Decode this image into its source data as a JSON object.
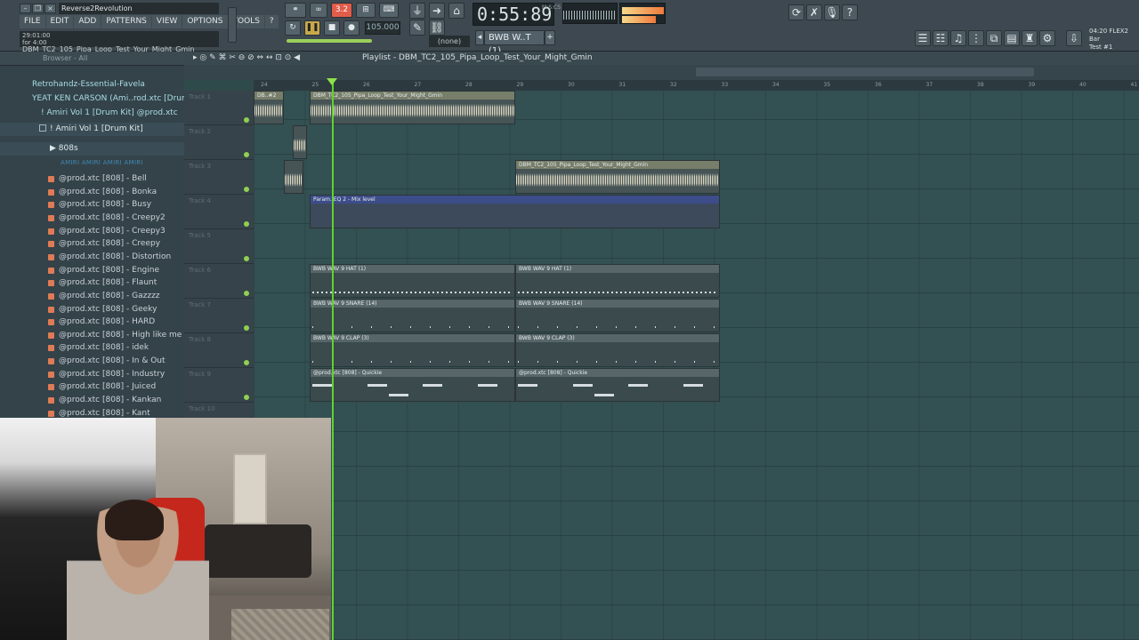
{
  "window": {
    "song_title": "Reverse2Revolution",
    "hint_line1": "29:01:00",
    "hint_line2": "for 4:00",
    "hint_file": "DBM_TC2_105_Pipa_Loop_Test_Your_Might_Gmin"
  },
  "menu": [
    "FILE",
    "EDIT",
    "ADD",
    "PATTERNS",
    "VIEW",
    "OPTIONS",
    "TOOLS",
    "?"
  ],
  "transport": {
    "pattern_indicator": "3.2",
    "tempo": "105.000",
    "time": "0:55:89",
    "time_unit": "M:S:CS",
    "pattern_select": "(none)",
    "channel_select": "BWB W..T (1)"
  },
  "info_right": {
    "line1": "04:20 FLEX2 Bar",
    "line2": "Test #1"
  },
  "browser": {
    "header": "Browser - All",
    "folders": [
      "Retrohandz-Essential-Favela",
      "YEAT KEN CARSON (Ami..rod.xtc [Drum Kit]",
      "! Amiri Vol 1 [Drum Kit] @prod.xtc",
      "! Amiri Vol 1 [Drum Kit]",
      "808s"
    ],
    "subfolder_tag": "AMIRI AMIRI AMIRI AMIRI",
    "files": [
      "@prod.xtc [808] - Bell",
      "@prod.xtc [808] - Bonka",
      "@prod.xtc [808] - Busy",
      "@prod.xtc [808] - Creepy2",
      "@prod.xtc [808] - Creepy3",
      "@prod.xtc [808] - Creepy",
      "@prod.xtc [808] - Distortion",
      "@prod.xtc [808] - Engine",
      "@prod.xtc [808] - Flaunt",
      "@prod.xtc [808] - Gazzzz",
      "@prod.xtc [808] - Geeky",
      "@prod.xtc [808] - HARD",
      "@prod.xtc [808] - High like me",
      "@prod.xtc [808] - idek",
      "@prod.xtc [808] - In & Out",
      "@prod.xtc [808] - Industry",
      "@prod.xtc [808] - Juiced",
      "@prod.xtc [808] - Kankan",
      "@prod.xtc [808] - Kant"
    ]
  },
  "playlist": {
    "title": "Playlist - DBM_TC2_105_Pipa_Loop_Test_Your_Might_Gmin",
    "ruler": [
      "24",
      "25",
      "26",
      "27",
      "28",
      "29",
      "30",
      "31",
      "32",
      "33",
      "34",
      "35",
      "36",
      "37",
      "38",
      "39",
      "40",
      "41"
    ],
    "tracks": [
      "Track 1",
      "Track 2",
      "Track 3",
      "Track 4",
      "Track 5",
      "Track 6",
      "Track 7",
      "Track 8",
      "Track 9",
      "Track 10"
    ],
    "clips": {
      "t1_small": "DB..#2",
      "t1_main": "DBM_TC2_105_Pipa_Loop_Test_Your_Might_Gmin",
      "t3_main": "DBM_TC2_105_Pipa_Loop_Test_Your_Might_Gmin",
      "t4_auto": "Param. EQ 2 - Mix level",
      "t6_a": "BWB WAV 9 HAT (1)",
      "t6_b": "BWB WAV 9 HAT (1)",
      "t7_a": "BWB WAV 9 SNARE (14)",
      "t7_b": "BWB WAV 9 SNARE (14)",
      "t8_a": "BWB WAV 9 CLAP (3)",
      "t8_b": "BWB WAV 9 CLAP (3)",
      "t9_a": "@prod.xtc [808] - Quickie",
      "t9_b": "@prod.xtc [808] - Quickie"
    }
  }
}
